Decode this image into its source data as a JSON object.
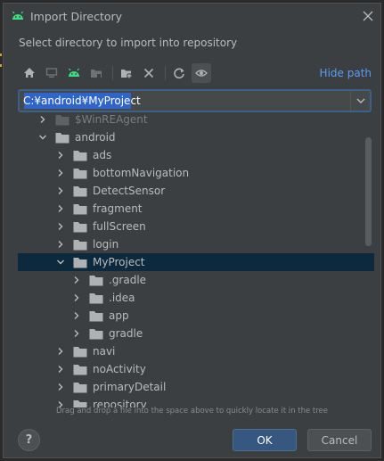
{
  "dialog": {
    "title": "Import Directory",
    "subtitle": "Select directory to import into repository",
    "close_icon": "close-icon"
  },
  "toolbar": {
    "buttons": [
      "home-icon",
      "desktop-icon",
      "android-icon",
      "project-folder-icon",
      "new-folder-icon",
      "delete-icon",
      "refresh-icon",
      "show-hidden-icon"
    ],
    "hide_path_label": "Hide path"
  },
  "path": {
    "value": "C:¥android¥MyProject"
  },
  "tree": {
    "rows": [
      {
        "label": "$WinREAgent",
        "expanded": false,
        "dim": true
      },
      {
        "label": "android",
        "expanded": true
      },
      {
        "label": "ads",
        "expanded": false
      },
      {
        "label": "bottomNavigation",
        "expanded": false
      },
      {
        "label": "DetectSensor",
        "expanded": false
      },
      {
        "label": "fragment",
        "expanded": false
      },
      {
        "label": "fullScreen",
        "expanded": false
      },
      {
        "label": "login",
        "expanded": false
      },
      {
        "label": "MyProject",
        "expanded": true,
        "selected": true
      },
      {
        "label": ".gradle",
        "expanded": false
      },
      {
        "label": ".idea",
        "expanded": false
      },
      {
        "label": "app",
        "expanded": false
      },
      {
        "label": "gradle",
        "expanded": false
      },
      {
        "label": "navi",
        "expanded": false
      },
      {
        "label": "noActivity",
        "expanded": false
      },
      {
        "label": "primaryDetail",
        "expanded": false
      },
      {
        "label": "repository",
        "expanded": false
      }
    ]
  },
  "hint": "Drag and drop a file into the space above to quickly locate it in the tree",
  "buttons": {
    "help_label": "?",
    "ok_label": "OK",
    "cancel_label": "Cancel"
  },
  "colors": {
    "accent": "#365880",
    "link": "#589df6",
    "selection": "#0d293e",
    "android_green": "#3ddc84"
  }
}
